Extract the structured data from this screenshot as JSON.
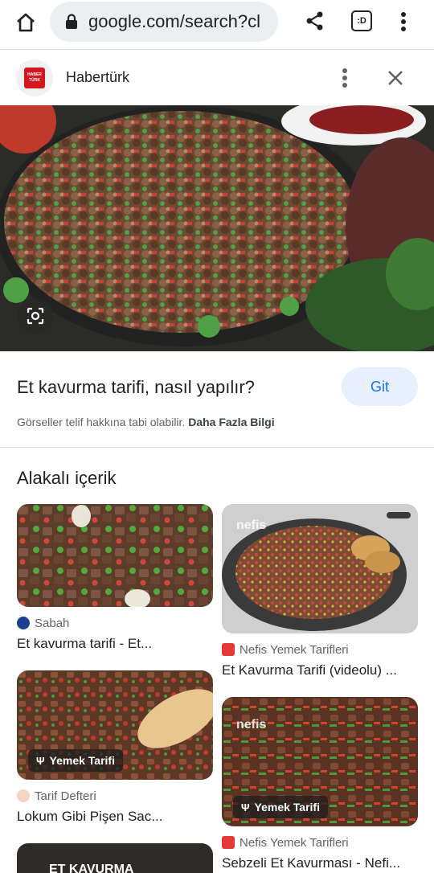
{
  "browser": {
    "url": "google.com/search?cl",
    "tab_count": ":D"
  },
  "source": {
    "name": "Habertürk",
    "logo_text": "HABER TÜRK"
  },
  "result": {
    "title": "Et kavurma tarifi, nasıl yapılır?",
    "go_label": "Git",
    "copyright_text": "Görseller telif hakkına tabi olabilir.",
    "more_info_label": "Daha Fazla Bilgi"
  },
  "related": {
    "heading": "Alakalı içerik",
    "cards": [
      {
        "source": "Sabah",
        "title": "Et kavurma tarifi - Et...",
        "chip": ""
      },
      {
        "source": "Nefis Yemek Tarifleri",
        "title": "Et Kavurma Tarifi (videolu) ...",
        "chip": "",
        "watermark": "nefis"
      },
      {
        "source": "Tarif Defteri",
        "title": "Lokum Gibi Pişen Sac...",
        "chip": "Yemek Tarifi"
      },
      {
        "source": "Nefis Yemek Tarifleri",
        "title": "Sebzeli Et Kavurması - Nefi...",
        "chip": "Yemek Tarifi",
        "watermark": "nefis"
      },
      {
        "source": "",
        "title": "",
        "chip": "",
        "overlay_text": "ET KAVURMA"
      }
    ]
  },
  "colors": {
    "accent": "#1a73e8",
    "go_button_bg": "#e8f0fe",
    "habertürk_red": "#d4181f",
    "nefis_red": "#e53935"
  }
}
